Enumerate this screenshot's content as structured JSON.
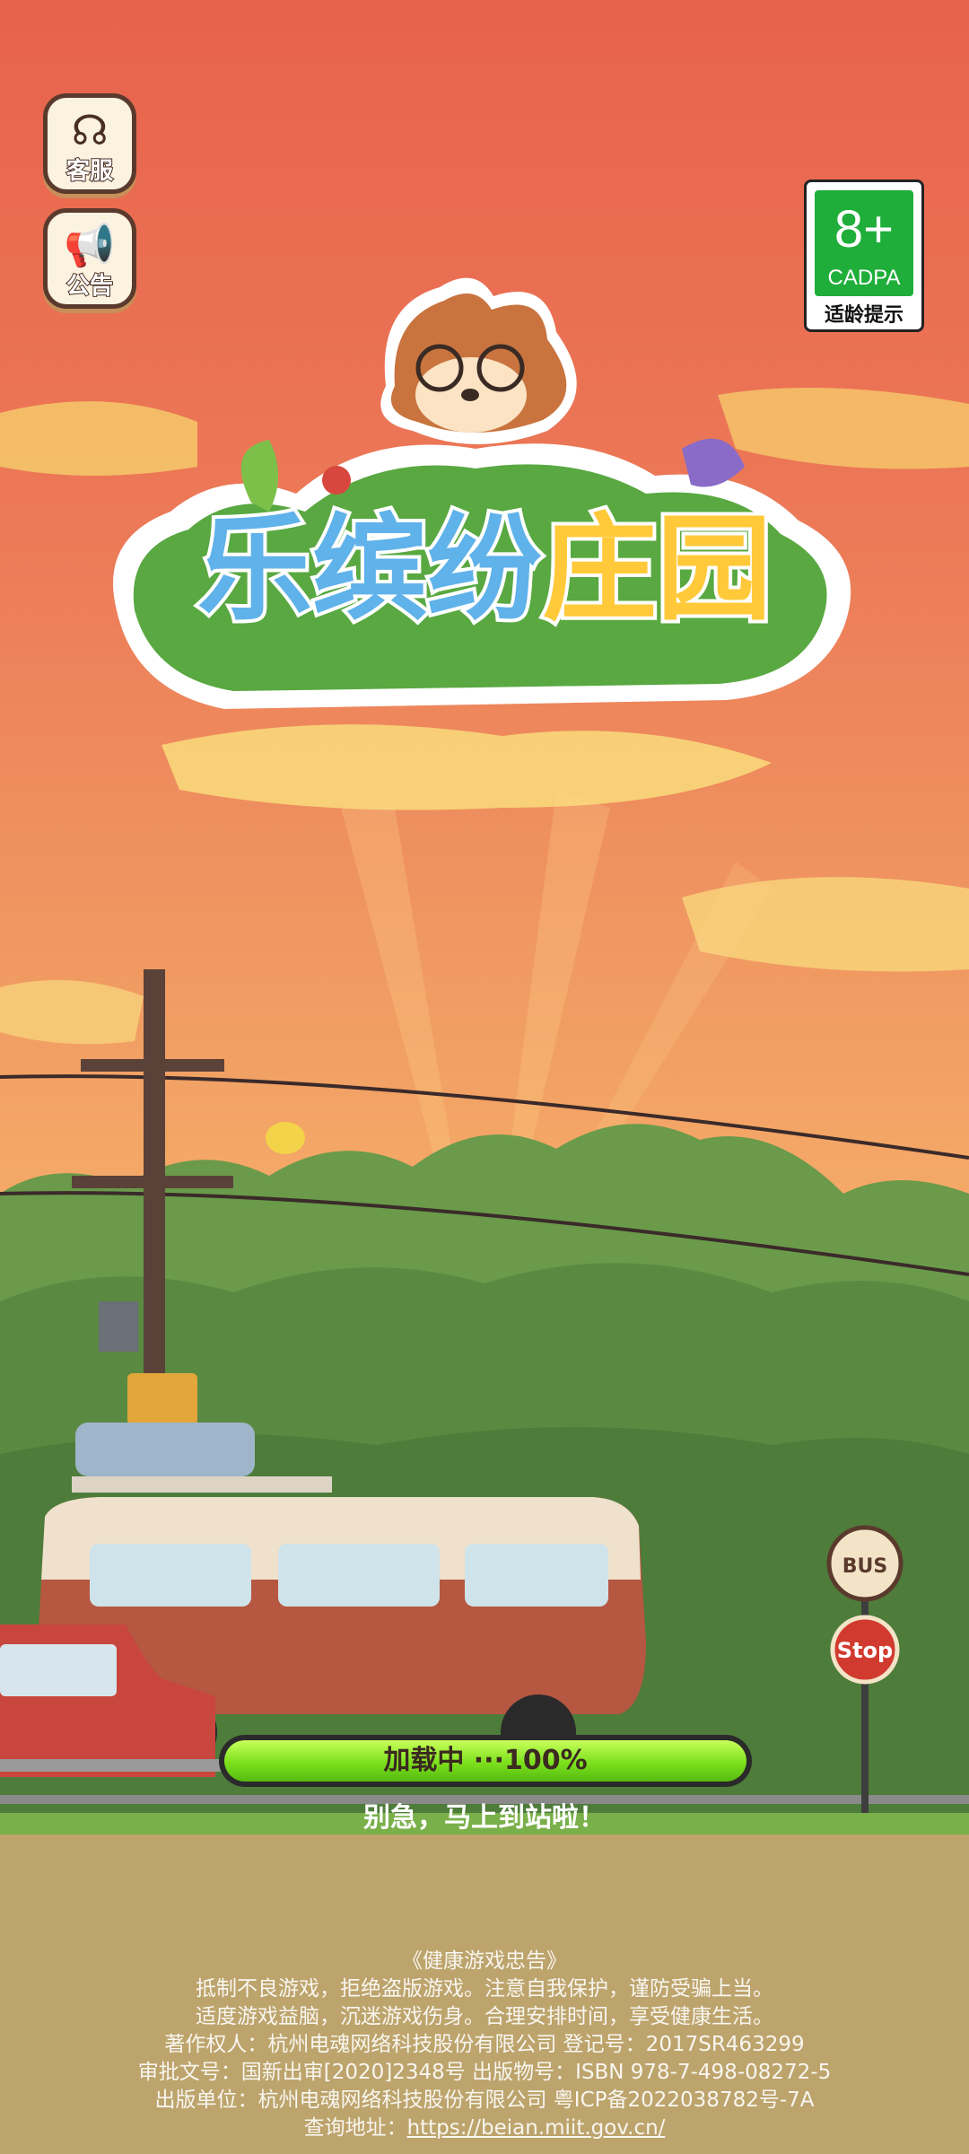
{
  "buttons": {
    "service": {
      "label": "客服",
      "icon": "headset-icon"
    },
    "notice": {
      "label": "公告",
      "icon": "megaphone-icon"
    }
  },
  "age_rating": {
    "value": "8+",
    "org": "CADPA",
    "tip": "适龄提示",
    "color": "#1fae3a"
  },
  "logo": {
    "chars": [
      "乐",
      "缤",
      "纷",
      "庄",
      "园"
    ]
  },
  "loading": {
    "text": "加载中 ···100%",
    "progress": 1.0,
    "hint": "别急，马上到站啦！"
  },
  "scene": {
    "bus_stop": "BUS",
    "stop_sign": "Stop"
  },
  "health_notice": {
    "title": "《健康游戏忠告》",
    "line1": "抵制不良游戏，拒绝盗版游戏。注意自我保护，谨防受骗上当。",
    "line2": "适度游戏益脑，沉迷游戏伤身。合理安排时间，享受健康生活。",
    "line3": "著作权人：杭州电魂网络科技股份有限公司  登记号：2017SR463299",
    "line4": "审批文号：国新出审[2020]2348号  出版物号：ISBN 978-7-498-08272-5",
    "line5": "出版单位：杭州电魂网络科技股份有限公司 粤ICP备2022038782号-7A",
    "query_label": "查询地址：",
    "query_url": "https://beian.miit.gov.cn/"
  }
}
